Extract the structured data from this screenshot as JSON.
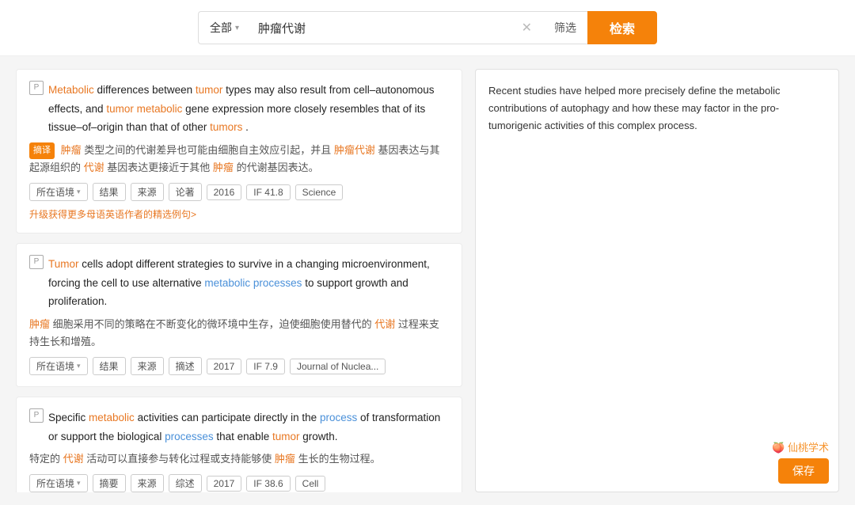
{
  "topbar": {
    "search_type": "全部",
    "search_type_chevron": "▾",
    "search_query": "肿瘤代谢",
    "clear_icon": "✕",
    "filter_label": "筛选",
    "search_btn_label": "检索"
  },
  "results": [
    {
      "id": 1,
      "en_parts": [
        {
          "text": "Metabolic",
          "style": "orange"
        },
        {
          "text": " differences between ",
          "style": "normal"
        },
        {
          "text": "tumor",
          "style": "orange"
        },
        {
          "text": " types may also result from cell–autonomous effects, and ",
          "style": "normal"
        },
        {
          "text": "tumor",
          "style": "orange"
        },
        {
          "text": " ",
          "style": "normal"
        },
        {
          "text": "metabolic",
          "style": "orange"
        },
        {
          "text": " gene expression more closely resembles that of its tissue–of–origin than that of other ",
          "style": "normal"
        },
        {
          "text": "tumors",
          "style": "orange"
        },
        {
          "text": ".",
          "style": "normal"
        }
      ],
      "zh_prefix": "肿瘤",
      "zh_text": "类型之间的代谢差异也可能由细胞自主效应引起，并且",
      "zh_highlight1": "肿瘤代谢",
      "zh_text2": "基因表达与其起源组织的",
      "zh_highlight2": "代谢",
      "zh_text3": "基因表达更接近于其他",
      "zh_highlight3": "肿瘤",
      "zh_text4": "的代谢基因表达。",
      "tags": [
        "所在语境",
        "结果",
        "来源",
        "论著",
        "2016",
        "IF 41.8",
        "Science"
      ],
      "upgrade_text": "升级获得更多母语英语作者的精选例句>"
    },
    {
      "id": 2,
      "en_parts": [
        {
          "text": "Tumor",
          "style": "orange"
        },
        {
          "text": " cells adopt different strategies to survive in a changing microenvironment, forcing the cell to use alternative ",
          "style": "normal"
        },
        {
          "text": "metabolic processes",
          "style": "blue"
        },
        {
          "text": " to support growth and proliferation.",
          "style": "normal"
        }
      ],
      "zh_prefix": "肿瘤",
      "zh_text": "细胞采用不同的策略在不断变化的微环境中生存，迫使细胞使用替代的",
      "zh_highlight2": "代谢",
      "zh_text3": "过程来支持生长和增殖。",
      "tags": [
        "所在语境",
        "结果",
        "来源",
        "摘述",
        "2017",
        "IF 7.9",
        "Journal of Nuclea..."
      ],
      "upgrade_text": ""
    },
    {
      "id": 3,
      "en_parts": [
        {
          "text": "Specific ",
          "style": "normal"
        },
        {
          "text": "metabolic",
          "style": "orange"
        },
        {
          "text": " activities can participate directly in the ",
          "style": "normal"
        },
        {
          "text": "process",
          "style": "blue"
        },
        {
          "text": " of transformation or support the biological ",
          "style": "normal"
        },
        {
          "text": "processes",
          "style": "blue"
        },
        {
          "text": " that enable ",
          "style": "normal"
        },
        {
          "text": "tumor",
          "style": "orange"
        },
        {
          "text": " growth.",
          "style": "normal"
        }
      ],
      "zh_text_full": "特定的",
      "zh_highlight1": "代谢",
      "zh_text2": "活动可以直接参与转化过程或支持能够使",
      "zh_highlight2": "肿瘤",
      "zh_text3": "生长的生物过程。",
      "tags": [
        "所在语境",
        "摘要",
        "来源",
        "综述",
        "2017",
        "IF 38.6",
        "Cell"
      ],
      "upgrade_text": ""
    }
  ],
  "right_panel": {
    "text": "Recent studies have helped more precisely define the metabolic contributions of autophagy and how these may factor in the pro-tumorigenic activities of this complex process.",
    "logo": "🍑 仙桃学术",
    "save_label": "保存"
  }
}
